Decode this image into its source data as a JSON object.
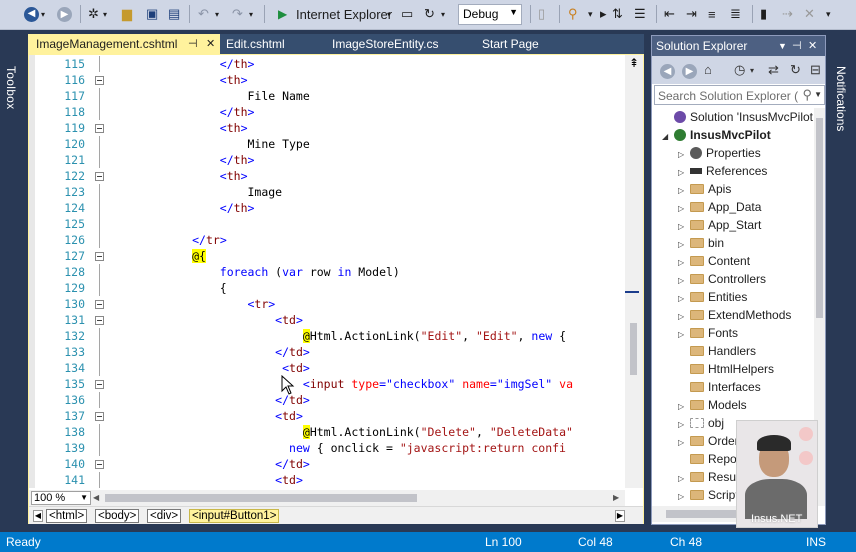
{
  "toolbar": {
    "run_label": "Internet Explorer",
    "config": "Debug"
  },
  "side": {
    "toolbox": "Toolbox",
    "notifications": "Notifications"
  },
  "tabs": [
    {
      "label": "ImageManagement.cshtml",
      "active": true
    },
    {
      "label": "Edit.cshtml",
      "active": false
    },
    {
      "label": "ImageStoreEntity.cs",
      "active": false
    },
    {
      "label": "Start Page",
      "active": false
    }
  ],
  "editor": {
    "line_numbers": [
      "115",
      "116",
      "117",
      "118",
      "119",
      "120",
      "121",
      "122",
      "123",
      "124",
      "125",
      "126",
      "127",
      "128",
      "129",
      "130",
      "131",
      "132",
      "133",
      "134",
      "135",
      "136",
      "137",
      "138",
      "139",
      "140",
      "141"
    ],
    "zoom": "100 %",
    "breadcrumb": [
      "<html>",
      "<body>",
      "<div>",
      "<input#Button1>"
    ]
  },
  "solution_explorer": {
    "title": "Solution Explorer",
    "search_placeholder": "Search Solution Explorer (",
    "tree": [
      {
        "label": "Solution 'InsusMvcPilot",
        "level": 0,
        "icon": "solution-icon",
        "expand": ""
      },
      {
        "label": "InsusMvcPilot",
        "level": 1,
        "icon": "project-icon",
        "expand": "◢",
        "bold": true
      },
      {
        "label": "Properties",
        "level": 2,
        "icon": "wrench-icon",
        "expand": "▷"
      },
      {
        "label": "References",
        "level": 2,
        "icon": "references-icon",
        "expand": "▷"
      },
      {
        "label": "Apis",
        "level": 2,
        "icon": "folder-icon",
        "expand": "▷"
      },
      {
        "label": "App_Data",
        "level": 2,
        "icon": "folder-icon",
        "expand": "▷"
      },
      {
        "label": "App_Start",
        "level": 2,
        "icon": "folder-icon",
        "expand": "▷"
      },
      {
        "label": "bin",
        "level": 2,
        "icon": "folder-icon",
        "expand": "▷"
      },
      {
        "label": "Content",
        "level": 2,
        "icon": "folder-icon",
        "expand": "▷"
      },
      {
        "label": "Controllers",
        "level": 2,
        "icon": "folder-icon",
        "expand": "▷"
      },
      {
        "label": "Entities",
        "level": 2,
        "icon": "folder-icon",
        "expand": "▷"
      },
      {
        "label": "ExtendMethods",
        "level": 2,
        "icon": "folder-icon",
        "expand": "▷"
      },
      {
        "label": "Fonts",
        "level": 2,
        "icon": "folder-icon",
        "expand": "▷"
      },
      {
        "label": "Handlers",
        "level": 2,
        "icon": "folder-icon",
        "expand": ""
      },
      {
        "label": "HtmlHelpers",
        "level": 2,
        "icon": "folder-icon",
        "expand": ""
      },
      {
        "label": "Interfaces",
        "level": 2,
        "icon": "folder-icon",
        "expand": ""
      },
      {
        "label": "Models",
        "level": 2,
        "icon": "folder-icon",
        "expand": "▷"
      },
      {
        "label": "obj",
        "level": 2,
        "icon": "folder-dotted-icon",
        "expand": "▷"
      },
      {
        "label": "Orders",
        "level": 2,
        "icon": "folder-icon",
        "expand": "▷"
      },
      {
        "label": "Reports",
        "level": 2,
        "icon": "folder-icon",
        "expand": ""
      },
      {
        "label": "Results",
        "level": 2,
        "icon": "folder-icon",
        "expand": "▷"
      },
      {
        "label": "Scripts",
        "level": 2,
        "icon": "folder-icon",
        "expand": "▷"
      }
    ]
  },
  "webcam": {
    "brand": "Insus.NET"
  },
  "status": {
    "ready": "Ready",
    "line": "Ln 100",
    "col": "Col 48",
    "ch": "Ch 48",
    "mode": "INS"
  }
}
